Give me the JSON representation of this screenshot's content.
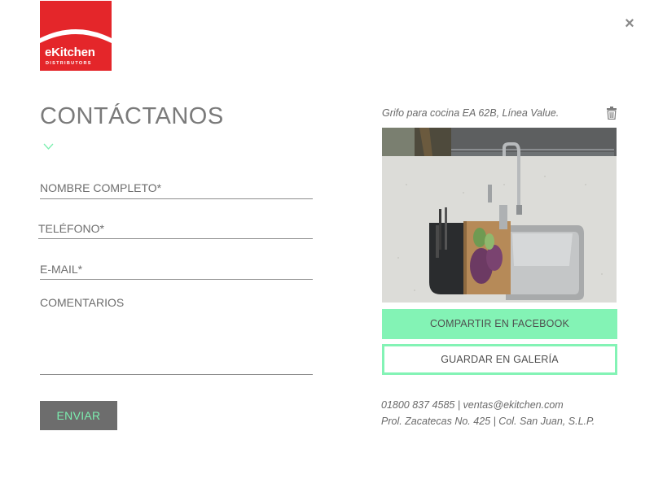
{
  "logo": {
    "word": "eKitchen",
    "subtitle": "DISTRIBUTORS",
    "color": "#e4262a"
  },
  "close": {
    "icon": "close-icon",
    "glyph": "×"
  },
  "form": {
    "title": "CONTÁCTANOS",
    "fields": {
      "name_placeholder": "NOMBRE COMPLETO*",
      "phone_placeholder": "TELÉFONO*",
      "email_placeholder": "E-MAIL*",
      "comments_placeholder": "COMENTARIOS"
    },
    "submit_label": "ENVIAR"
  },
  "product": {
    "caption": "Grifo para cocina EA 62B, Línea Value.",
    "share_facebook_label": "COMPARTIR EN FACEBOOK",
    "save_gallery_label": "GUARDAR EN GALERÍA"
  },
  "contact": {
    "line1": "01800 837 4585 | ventas@ekitchen.com",
    "line2": "Prol. Zacatecas No. 425 | Col. San Juan, S.L.P."
  },
  "colors": {
    "accent": "#83f3b5",
    "brand_red": "#e4262a",
    "button_gray": "#6d6d6d"
  }
}
